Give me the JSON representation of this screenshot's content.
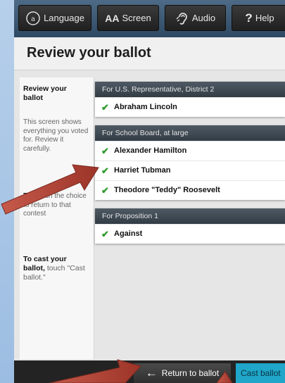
{
  "toolbar": {
    "language_label": "Language",
    "screen_label": "Screen",
    "screen_glyph": "AA",
    "audio_label": "Audio",
    "help_label": "Help"
  },
  "page": {
    "title": "Review your ballot"
  },
  "sidebar": {
    "heading": "Review your ballot",
    "p1": "This screen shows everything you voted for. Review it carefully.",
    "p2_bold": "To",
    "p2": ", touch the choice to return to that contest",
    "cast_bold": "To cast your ballot,",
    "cast_rest": " touch \"Cast ballot.\""
  },
  "contests": [
    {
      "title": "For U.S. Representative, District 2",
      "choices": [
        "Abraham Lincoln"
      ]
    },
    {
      "title": "For School Board, at large",
      "choices": [
        "Alexander Hamilton",
        "Harriet Tubman",
        "Theodore \"Teddy\" Roosevelt"
      ]
    },
    {
      "title": "For Proposition 1",
      "choices": [
        "Against"
      ]
    }
  ],
  "footer": {
    "return_label": "Return to ballot",
    "cast_label": "Cast ballot"
  },
  "colors": {
    "check": "#2f9a2c",
    "cast_button": "#1fa6c9",
    "arrow": "#b5473a"
  }
}
